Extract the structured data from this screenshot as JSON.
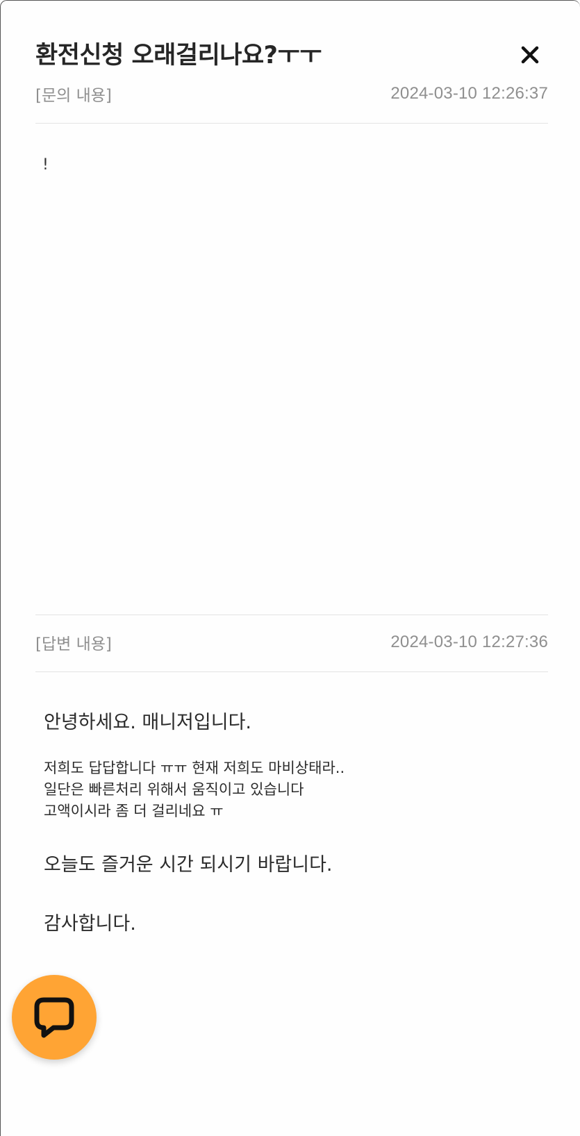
{
  "modal": {
    "title": "환전신청 오래걸리나요?ㅜㅜ",
    "close_icon": "close-icon"
  },
  "question": {
    "label": "[문의 내용]",
    "date": "2024-03-10 12:26:37",
    "body": "!"
  },
  "answer": {
    "label": "[답변 내용]",
    "date": "2024-03-10 12:27:36",
    "greeting": "안녕하세요. 매니저입니다.",
    "lines": [
      "저희도 답답합니다 ㅠㅠ 현재 저희도 마비상태라..",
      "일단은 빠른처리 위해서 움직이고 있습니다",
      "고액이시라 좀 더 걸리네요 ㅠ"
    ],
    "closing": "오늘도 즐거운 시간 되시기 바랍니다.",
    "thanks": "감사합니다."
  },
  "chat_button": {
    "icon": "chat-bubble-icon",
    "color": "#ffa434"
  }
}
